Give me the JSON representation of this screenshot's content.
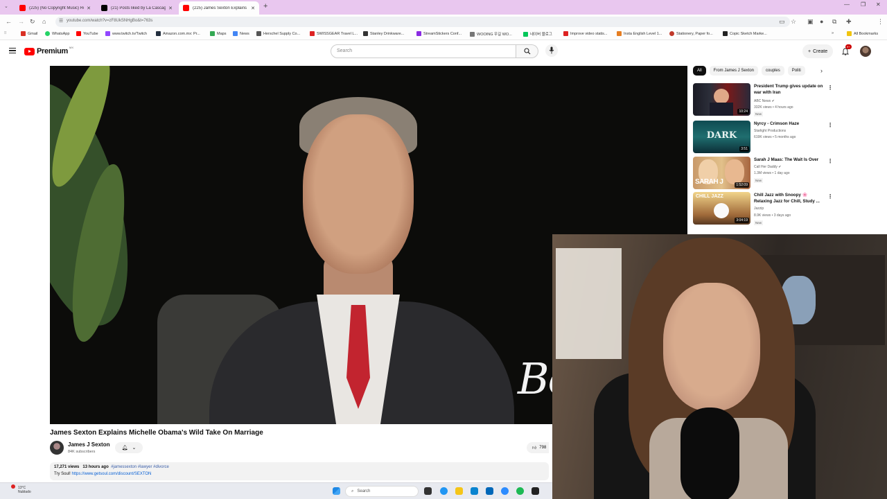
{
  "browser": {
    "tabs": [
      {
        "title": "(225) (No Copyright Music) Ro",
        "color": "#ff0000"
      },
      {
        "title": "(21) Posts liked by La Cascagio",
        "color": "#000000"
      },
      {
        "title": "(225) James Sexton Explains M",
        "color": "#ff0000"
      }
    ],
    "new_tab": "+",
    "url": "youtube.com/watch?v=zF8UkSNHgBo&t=763s",
    "bookmarks": [
      {
        "label": "Gmail",
        "color": "#d93025"
      },
      {
        "label": "WhatsApp",
        "color": "#25d366"
      },
      {
        "label": "YouTube",
        "color": "#ff0000"
      },
      {
        "label": "www.twitch.tv/Twitch",
        "color": "#9146ff"
      },
      {
        "label": "Amazon.com.mx: Pr...",
        "color": "#232f3e"
      },
      {
        "label": "Maps",
        "color": "#34a853"
      },
      {
        "label": "News",
        "color": "#4285f4"
      },
      {
        "label": "Herschel Supply Co...",
        "color": "#555555"
      },
      {
        "label": "SWISSGEAR Travel L...",
        "color": "#d22"
      },
      {
        "label": "Stanley Drinkware...",
        "color": "#333333"
      },
      {
        "label": "StreamStickers Conf...",
        "color": "#8a2be2"
      },
      {
        "label": "WOOING 우길 WO...",
        "color": "#777777"
      },
      {
        "label": "네이버 블로그",
        "color": "#03c75a"
      },
      {
        "label": "Improve video statis...",
        "color": "#d22"
      },
      {
        "label": "Insta English Level 1...",
        "color": "#e67e22"
      },
      {
        "label": "Stationery, Paper fo...",
        "color": "#c0392b"
      },
      {
        "label": "Copic Sketch Marke...",
        "color": "#222222"
      }
    ],
    "all_bookmarks": "All Bookmarks"
  },
  "youtube": {
    "logo_text": "Premium",
    "country_code": "MX",
    "search_placeholder": "Search",
    "create_label": "Create",
    "notifications": "9+",
    "video": {
      "overlay_text": "Be",
      "title": "James Sexton Explains Michelle Obama's Wild Take On Marriage",
      "channel": "James J Sexton",
      "subscribers": "84K subscribers",
      "likes": "798",
      "views": "17,271 views",
      "age": "13 hours ago",
      "hashtags": "#jamessexton #lawyer #divorce",
      "promo_text": "Try Soul! ",
      "promo_link": "https://www.getsoul.com/discount/SEXTON"
    },
    "chips": [
      "All",
      "From James J Sexton",
      "couples",
      "Politi"
    ],
    "recommendations": [
      {
        "title": "President Trump gives update on war with Iran",
        "channel": "ABC News",
        "verified": "✔",
        "meta": "332K views • 4 hours ago",
        "badge": "New",
        "duration": "10:24",
        "thumb": "trump"
      },
      {
        "title": "Nyrcy - Crimson Haze",
        "channel": "Starlight Productions",
        "verified": "",
        "meta": "619K views • 5 months ago",
        "badge": "",
        "duration": "3:51",
        "thumb_text": "DARK",
        "thumb": "dark"
      },
      {
        "title": "Sarah J Maas: The Wait Is Over",
        "channel": "Call Her Daddy",
        "verified": "✔",
        "meta": "1.3M views • 1 day ago",
        "badge": "New",
        "duration": "1:52:09",
        "thumb_text": "SARAH J",
        "thumb": "sarah"
      },
      {
        "title": "Chill Jazz with Snoopy 🌸 Relaxing Jazz for Chill, Study ...",
        "channel": "Jazzip",
        "verified": "",
        "meta": "8.9K views • 3 days ago",
        "badge": "New",
        "duration": "3:04:19",
        "thumb_text": "CHILL JAZZ",
        "thumb": "jazz"
      }
    ]
  },
  "taskbar": {
    "temperature": "13°C",
    "condition": "Nublado",
    "search_placeholder": "Search"
  }
}
